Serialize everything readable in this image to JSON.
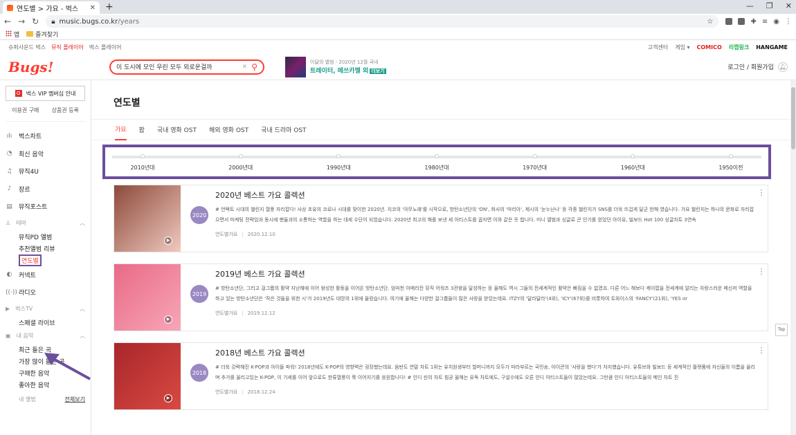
{
  "browser": {
    "tab_title": "연도별 > 가요 - 벅스",
    "url_domain": "music.bugs.co.kr",
    "url_path": "/years",
    "bookmarks": [
      "앱",
      "즐겨찾기"
    ]
  },
  "util": {
    "left": [
      "슈퍼사운드 벅스",
      "뮤직 플레이어",
      "벅스 플레이어"
    ],
    "right": [
      "고객센터",
      "게임 ▾"
    ],
    "brands": [
      "COMICO",
      "리캡링크",
      "HANGAME"
    ]
  },
  "header": {
    "logo": "Bugs!",
    "search_value": "이 도시에 모인 우린 모두 외로운걸까",
    "promo_sub": "이달의 앨범 - 2020년 12월 국내",
    "promo_title": "트레이터, 메쓰카멜 외",
    "promo_badge": "더보기",
    "login": "로그인 / 회원가입"
  },
  "sidebar": {
    "vip": "벅스 VIP 멤버십 안내",
    "vip_links": [
      "이용권 구매",
      "상품권 등록"
    ],
    "items": [
      {
        "icon": "chart-icon",
        "glyph": "ılı",
        "label": "벅스차트"
      },
      {
        "icon": "new-music-icon",
        "glyph": "◔",
        "label": "최신 음악"
      },
      {
        "icon": "music4u-icon",
        "glyph": "♫",
        "label": "뮤직4U"
      },
      {
        "icon": "genre-icon",
        "glyph": "♪",
        "label": "장르"
      },
      {
        "icon": "musicpost-icon",
        "glyph": "▤",
        "label": "뮤직포스트"
      }
    ],
    "theme_section": "테마",
    "theme_items": [
      "뮤직PD 앨범",
      "추천앨범 리뷰",
      "연도별"
    ],
    "items2": [
      {
        "icon": "connect-icon",
        "glyph": "◐",
        "label": "커넥트"
      },
      {
        "icon": "radio-icon",
        "glyph": "((·))",
        "label": "라디오"
      }
    ],
    "tv_section": "벅스TV",
    "tv_items": [
      "스페셜 라이브"
    ],
    "my_section": "내 음악",
    "my_items": [
      "최근 들은 곡",
      "가장 많이 들은 곡",
      "구매한 음악",
      "좋아한 음악"
    ],
    "my_album": "내 앨범",
    "view_all": "전체보기"
  },
  "main": {
    "title": "연도별",
    "tabs": [
      "가요",
      "팝",
      "국내 영화 OST",
      "해외 영화 OST",
      "국내 드라마 OST"
    ],
    "decades": [
      "2010년대",
      "2000년대",
      "1990년대",
      "1980년대",
      "1970년대",
      "1960년대",
      "1950이전"
    ],
    "cards": [
      {
        "year": "2020",
        "title": "2020년 베스트 가요 콜렉션",
        "desc": "# 언택트 시대의 챌린지 열풍 자리잡다! 사상 초유의 코로나 시대를 맞이한 2020년. 지코의 '아무노래'를 시작으로, 방탄소년단의 'ON', 화사의 '마리아', 제시의 '눈누난나' 등 각종 챌린지가 SNS를 더욱 뜨겁게 달군 한해 였습니다. 가요 챌린지는 하나의 문화로 자리잡으면서 마케팅 전략임과 동시에 팬들과의 소통하는 역할을 하는 대세 수단이 되었습니다. 2020년 최고의 해를 보낸 세 아티스트를 꼽자면 이와 같은 듯 합니다. 미니 앨범과 싱글로 큰 인기를 얻었던 아이유, 빌보드 Hot 100 싱글차트 3연속",
        "type": "연도별가요",
        "date": "2020.12.10",
        "colors": [
          "#8c4a3a",
          "#f0c9c0"
        ]
      },
      {
        "year": "2019",
        "title": "2019년 베스트 가요 콜렉션",
        "desc": "# 방탄소년단, 그리고 걸그룹의 활약 지난해에 이어 왕성한 활동을 이어온 방탄소년단. 엄마천 아메리칸 뮤직 어워즈 3관왕을 달성하는 등 올해도 역시 그들의 전세계적인 활약은 빠짐을 수 없겠죠. 다른 어느 해보다 케이팝을 전세계에 알리는 자랑스러운 메신저 역할을 하고 있는 방탄소년단은 '작은 것들을 위한 시'가 2019년도 대망의 1위에 올랐습니다. 여기에 올해는 다양한 걸그룹들이 많은 사랑을 받았는데요. ITZY의 '달라달라'(4위), 'ICY'(67위)를 비롯하여 트와이스의 'FANCY'(21위), 'YES or",
        "type": "연도별가요",
        "date": "2019.12.12",
        "colors": [
          "#e96a86",
          "#f7a6b8"
        ]
      },
      {
        "year": "2018",
        "title": "2018년 베스트 가요 콜렉션",
        "desc": "# 더욱 강력해진 K-POP과 아이돌 파워! 2018년에도 K-POP의 영향력은 굉장했는데요. 음반도 연말 차트 1위는 유치원생부터 할머니까지 모두가 따라부르는 국민송, 아이콘의 '사랑을 했다'가 차지했습니다. 유튜브와 빌보드 등 세계적인 플랫폼에 자신들의 이름을 올리며 추가를 올리고있는 K-POP, 이 기세를 이어 앞으로도 한류열풍이 쭉 이어지기를 응원합니다! # 인디 씬의 차트 침공 올해는 유독 차트에도, 구설수에도 오른 인디 아티스트들이 많았는데요. 그만큼 인디 아티스트들의 메인 차트 진",
        "type": "연도별가요",
        "date": "2018.12.24",
        "colors": [
          "#a8262b",
          "#d94a42"
        ]
      }
    ],
    "top_button": "Top"
  },
  "accent_colors": {
    "brand": "#ff3b30",
    "highlight": "#6b4f9e"
  }
}
